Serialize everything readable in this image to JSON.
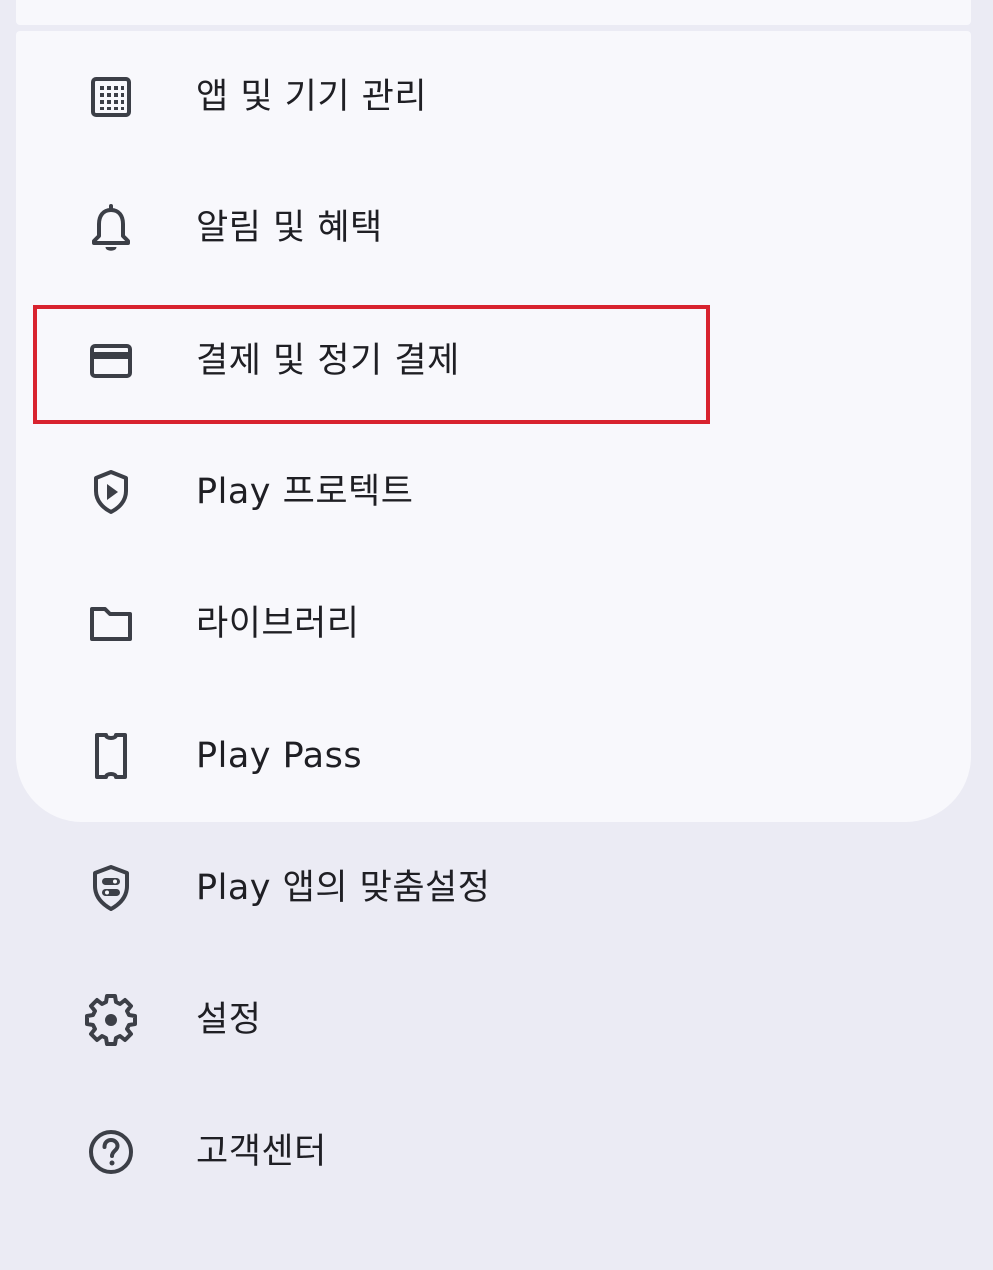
{
  "menu": {
    "items": [
      {
        "key": "manage_apps",
        "label": "앱 및 기기 관리",
        "icon": "grid-icon"
      },
      {
        "key": "notifications",
        "label": "알림 및 혜택",
        "icon": "bell-icon"
      },
      {
        "key": "payments",
        "label": "결제 및 정기 결제",
        "icon": "credit-card-icon"
      },
      {
        "key": "play_protect",
        "label": "Play 프로텍트",
        "icon": "shield-play-icon"
      },
      {
        "key": "library",
        "label": "라이브러리",
        "icon": "folder-icon"
      },
      {
        "key": "play_pass",
        "label": "Play Pass",
        "icon": "ticket-icon"
      },
      {
        "key": "personalization",
        "label": "Play 앱의 맞춤설정",
        "icon": "shield-toggle-icon"
      },
      {
        "key": "settings",
        "label": "설정",
        "icon": "gear-icon"
      },
      {
        "key": "help",
        "label": "고객센터",
        "icon": "help-icon"
      }
    ]
  },
  "colors": {
    "card_background": "#f8f8fc",
    "page_background": "#ebebf4",
    "text": "#1f1f24",
    "icon": "#3c3f47",
    "highlight": "#d8232f"
  },
  "highlighted_item": "payments"
}
